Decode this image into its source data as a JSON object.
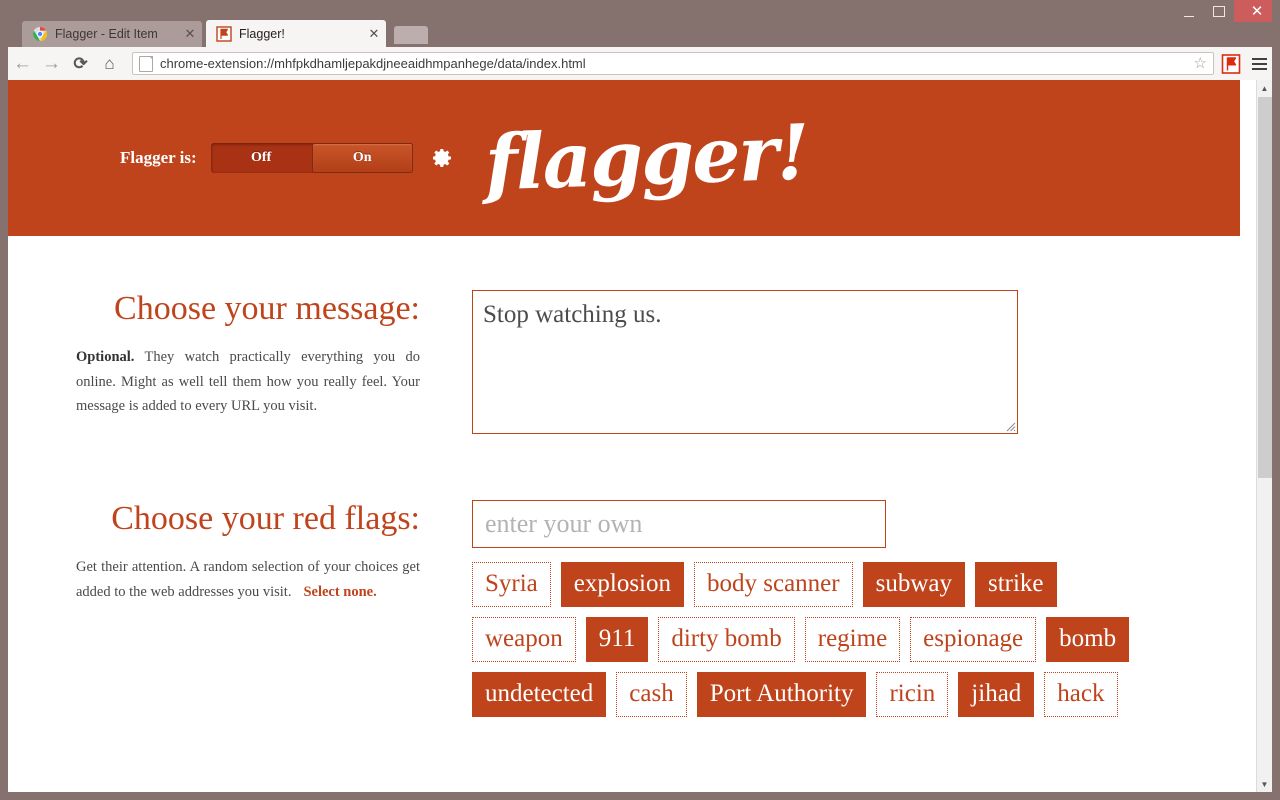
{
  "browser": {
    "window_controls": {
      "minimize_label": "–",
      "maximize_label": "",
      "close_label": "✕"
    },
    "tabs": [
      {
        "title": "Flagger - Edit Item",
        "active": false,
        "favicon": "chrome-icon",
        "close_label": "✕"
      },
      {
        "title": "Flagger!",
        "active": true,
        "favicon": "flag-icon",
        "close_label": "✕"
      }
    ],
    "nav": {
      "back_label": "←",
      "forward_label": "→",
      "reload_label": "⟳",
      "home_label": "⌂"
    },
    "omnibox": {
      "url": "chrome-extension://mhfpkdhamljepakdjneeaidhmpanhege/data/index.html",
      "star_label": "☆"
    },
    "extension_icon_name": "flagger-extension-icon",
    "menu_icon_name": "hamburger-menu-icon"
  },
  "app_header": {
    "status_label": "Flagger is:",
    "toggle": {
      "off_label": "Off",
      "on_label": "On",
      "selected": "On"
    },
    "settings_icon_name": "gear-icon",
    "logo_text": "flagger!",
    "background_color": "#bf441c"
  },
  "message_section": {
    "heading": "Choose your message:",
    "desc_bold": "Optional.",
    "desc_rest": " They watch practically everything you do online. Might as well tell them how you really feel. Your message is added to every URL you visit.",
    "textarea_value": "Stop watching us.",
    "textarea_placeholder": ""
  },
  "flags_section": {
    "heading": "Choose your red flags:",
    "desc": "Get their attention. A random selection of your choices get added to the web addresses you visit.",
    "select_none_label": "Select none.",
    "own_flag_placeholder": "enter your own",
    "own_flag_value": "",
    "flags": [
      {
        "label": "Syria",
        "selected": false
      },
      {
        "label": "explosion",
        "selected": true
      },
      {
        "label": "body scanner",
        "selected": false
      },
      {
        "label": "subway",
        "selected": true
      },
      {
        "label": "strike",
        "selected": true
      },
      {
        "label": "weapon",
        "selected": false
      },
      {
        "label": "911",
        "selected": true
      },
      {
        "label": "dirty bomb",
        "selected": false
      },
      {
        "label": "regime",
        "selected": false
      },
      {
        "label": "espionage",
        "selected": false
      },
      {
        "label": "bomb",
        "selected": true
      },
      {
        "label": "undetected",
        "selected": true
      },
      {
        "label": "cash",
        "selected": false
      },
      {
        "label": "Port Authority",
        "selected": true
      },
      {
        "label": "ricin",
        "selected": false
      },
      {
        "label": "jihad",
        "selected": true
      },
      {
        "label": "hack",
        "selected": false
      }
    ]
  },
  "colors": {
    "accent": "#bf441c",
    "titlebar": "#85726f",
    "close_button": "#cd5c5c"
  }
}
